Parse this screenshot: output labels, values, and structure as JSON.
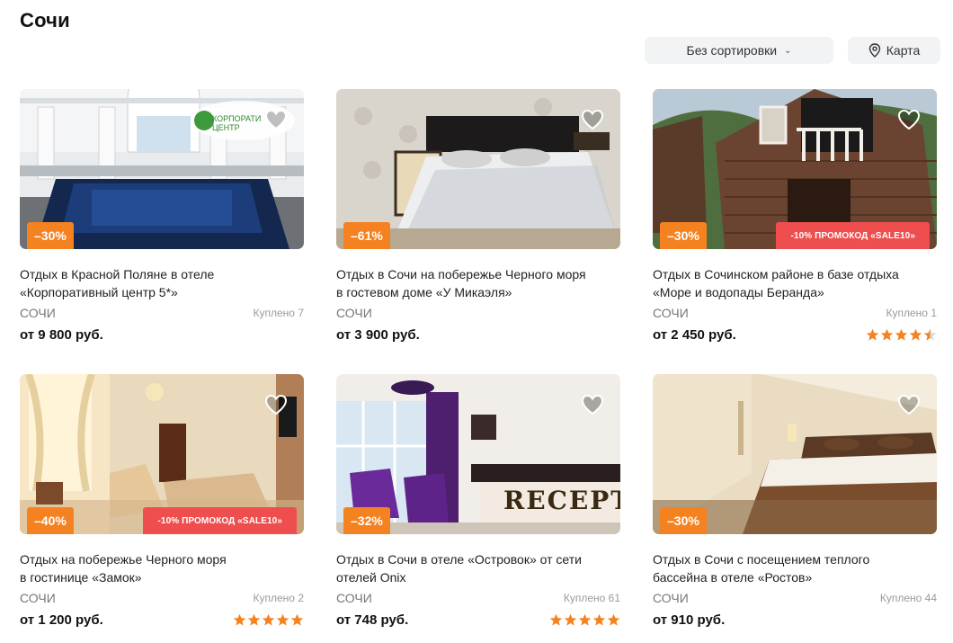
{
  "page": {
    "title": "Сочи"
  },
  "toolbar": {
    "sort_label": "Без сортировки",
    "map_label": "Карта"
  },
  "colors": {
    "discount": "#f58220",
    "promo": "#ee4e4e",
    "star": "#f58220",
    "button_bg": "#f2f3f5"
  },
  "cards": [
    {
      "title_line1": "Отдых в Красной Поляне в отеле",
      "title_line2": "«Корпоративный центр 5*»",
      "city": "СОЧИ",
      "bought": "Куплено 7",
      "price": "от 9 800 руб.",
      "discount": "–30%",
      "promo": "",
      "rating": 0,
      "logo_text": "КОРПОРАТИ ЦЕНТР"
    },
    {
      "title_line1": "Отдых в Сочи на побережье Черного моря",
      "title_line2": "в гостевом доме «У Микаэля»",
      "city": "СОЧИ",
      "bought": "",
      "price": "от 3 900 руб.",
      "discount": "–61%",
      "promo": "",
      "rating": 0
    },
    {
      "title_line1": "Отдых в Сочинском районе в базе отдыха",
      "title_line2": "«Море и водопады Беранда»",
      "city": "СОЧИ",
      "bought": "Куплено 1",
      "price": "от 2 450 руб.",
      "discount": "–30%",
      "promo": "-10% ПРОМОКОД «SALE10»",
      "rating": 4.5
    },
    {
      "title_line1": "Отдых на побережье Черного моря",
      "title_line2": "в гостинице «Замок»",
      "city": "СОЧИ",
      "bought": "Куплено 2",
      "price": "от 1 200 руб.",
      "discount": "–40%",
      "promo": "-10% ПРОМОКОД «SALE10»",
      "rating": 5
    },
    {
      "title_line1": "Отдых в Сочи в отеле «Островок» от сети",
      "title_line2": "отелей Onix",
      "city": "СОЧИ",
      "bought": "Куплено 61",
      "price": "от 748 руб.",
      "discount": "–32%",
      "promo": "",
      "rating": 5,
      "sign_text": "RECEPT"
    },
    {
      "title_line1": "Отдых в Сочи с посещением теплого",
      "title_line2": "бассейна в отеле «Ростов»",
      "city": "СОЧИ",
      "bought": "Куплено 44",
      "price": "от 910 руб.",
      "discount": "–30%",
      "promo": "",
      "rating": 0
    }
  ]
}
